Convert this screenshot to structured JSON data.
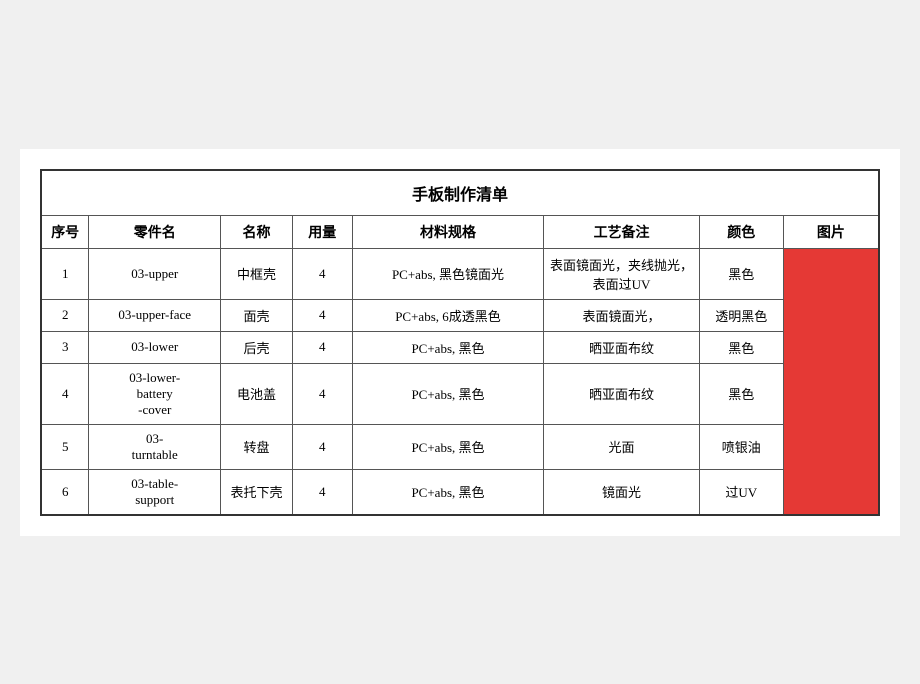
{
  "title": "手板制作清单",
  "headers": [
    "序号",
    "零件名",
    "名称",
    "用量",
    "材料规格",
    "工艺备注",
    "颜色",
    "图片"
  ],
  "rows": [
    {
      "seq": "1",
      "part": "03-upper",
      "name": "中框壳",
      "qty": "4",
      "material": "PC+abs, 黑色镜面光",
      "process": "表面镜面光，夹线抛光，表面过UV",
      "color": "黑色"
    },
    {
      "seq": "2",
      "part": "03-upper-face",
      "name": "面壳",
      "qty": "4",
      "material": "PC+abs, 6成透黑色",
      "process": "表面镜面光，",
      "color": "透明黑色"
    },
    {
      "seq": "3",
      "part": "03-lower",
      "name": "后壳",
      "qty": "4",
      "material": "PC+abs, 黑色",
      "process": "晒亚面布纹",
      "color": "黑色"
    },
    {
      "seq": "4",
      "part": "03-lower-battery-cover",
      "name": "电池盖",
      "qty": "4",
      "material": "PC+abs, 黑色",
      "process": "晒亚面布纹",
      "color": "黑色"
    },
    {
      "seq": "5",
      "part": "03-turntable",
      "name": "转盘",
      "qty": "4",
      "material": "PC+abs, 黑色",
      "process": "光面",
      "color": "喷银油"
    },
    {
      "seq": "6",
      "part": "03-table-support",
      "name": "表托下壳",
      "qty": "4",
      "material": "PC+abs, 黑色",
      "process": "镜面光",
      "color": "过UV"
    }
  ]
}
